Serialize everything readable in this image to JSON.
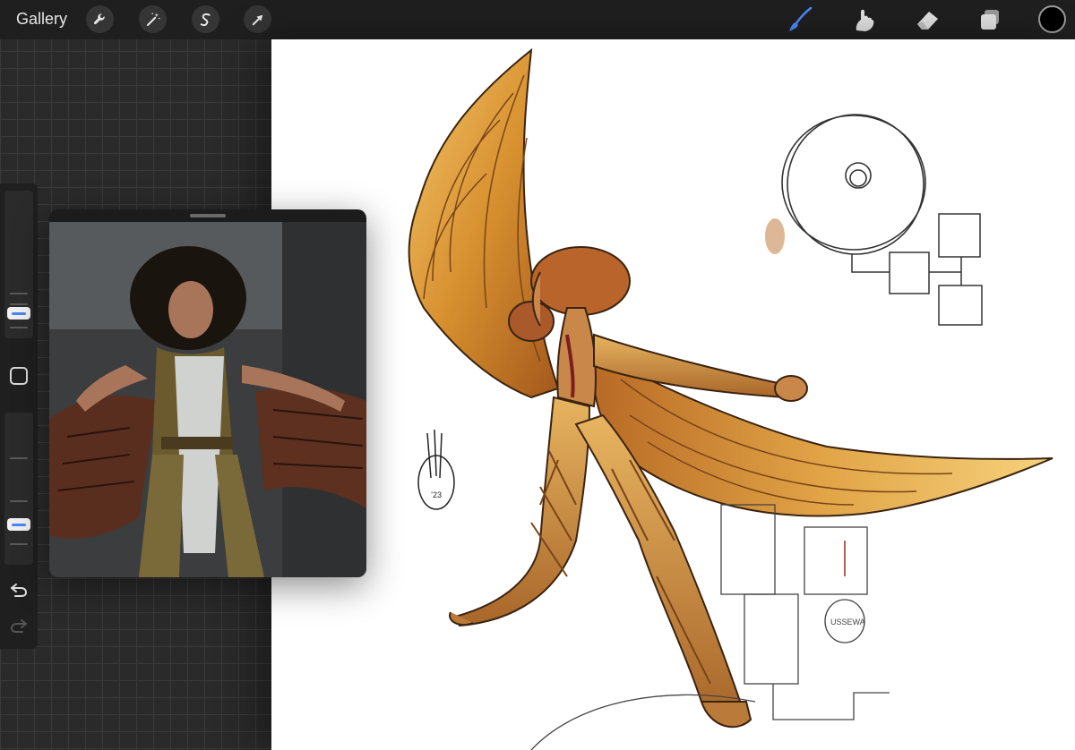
{
  "app": {
    "gallery_label": "Gallery"
  },
  "toolbar": {
    "left_tools": [
      {
        "name": "actions",
        "icon": "wrench-icon"
      },
      {
        "name": "adjustments",
        "icon": "magic-wand-icon"
      },
      {
        "name": "selection",
        "icon": "selection-s-icon"
      },
      {
        "name": "transform",
        "icon": "arrow-cursor-icon"
      }
    ],
    "right_tools": [
      {
        "name": "brush",
        "icon": "brush-icon",
        "active": true
      },
      {
        "name": "smudge",
        "icon": "smudge-finger-icon",
        "active": false
      },
      {
        "name": "eraser",
        "icon": "eraser-icon",
        "active": false
      },
      {
        "name": "layers",
        "icon": "layers-icon",
        "active": false
      }
    ],
    "active_color": "#000000",
    "accent_color": "#4a86f7"
  },
  "sidebar": {
    "brush_size_level": 0.25,
    "opacity_level": 0.2,
    "modify_button_icon": "square-icon",
    "undo_icon": "undo-icon",
    "redo_icon": "redo-icon",
    "redo_enabled": false
  },
  "reference_panel": {
    "type": "image reference",
    "icon": "drag-handle-icon"
  },
  "canvas": {
    "background": "#ffffff",
    "sketch_text": [
      "’23",
      "USSEWA"
    ]
  }
}
